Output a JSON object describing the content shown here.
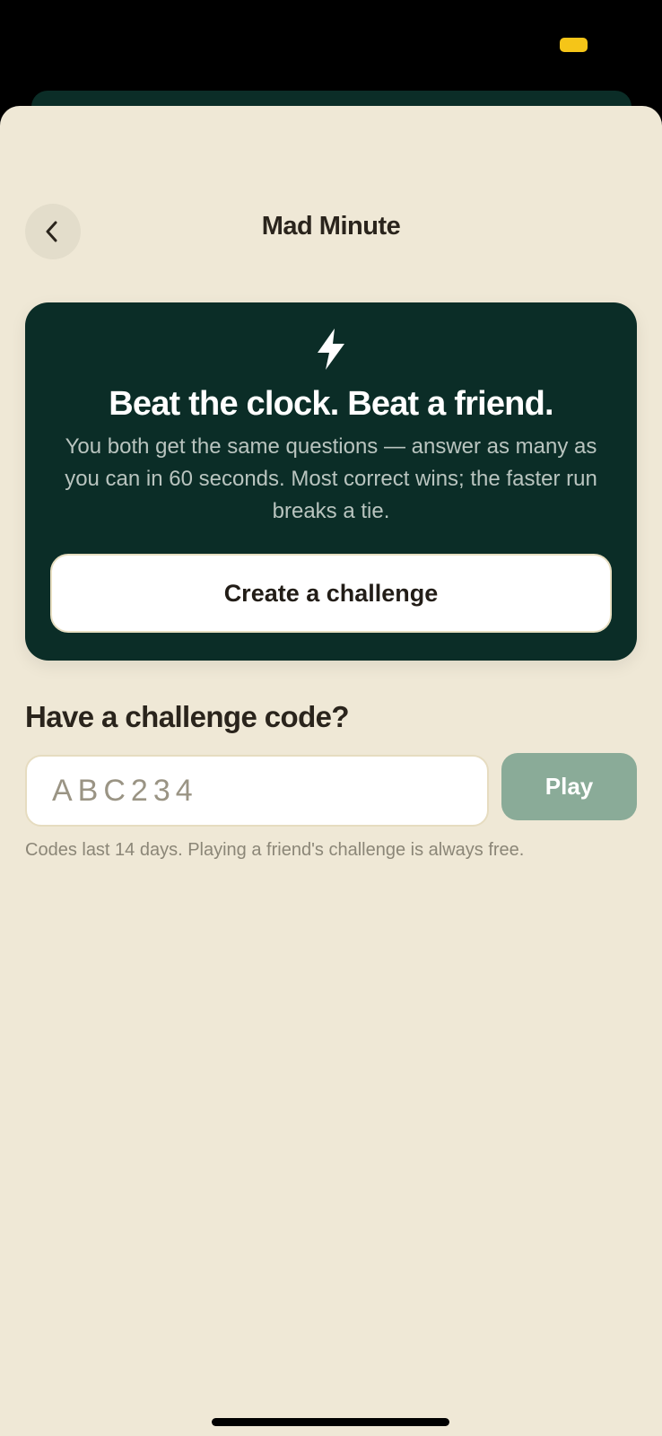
{
  "colors": {
    "sheet_background": "#efe8d6",
    "hero_background": "#0b2d27",
    "play_button": "#8aab98",
    "status_indicator": "#f5c518"
  },
  "header": {
    "back_icon": "chevron-left-icon",
    "title": "Mad Minute"
  },
  "hero": {
    "icon": "lightning-bolt-icon",
    "title": "Beat the clock. Beat a friend.",
    "description": "You both get the same questions — answer as many as you can in 60 seconds. Most correct wins; the faster run breaks a tie.",
    "create_button_label": "Create a challenge"
  },
  "join": {
    "heading": "Have a challenge code?",
    "code_placeholder": "ABC234",
    "code_value": "",
    "play_button_label": "Play",
    "hint": "Codes last 14 days. Playing a friend's challenge is always free."
  }
}
